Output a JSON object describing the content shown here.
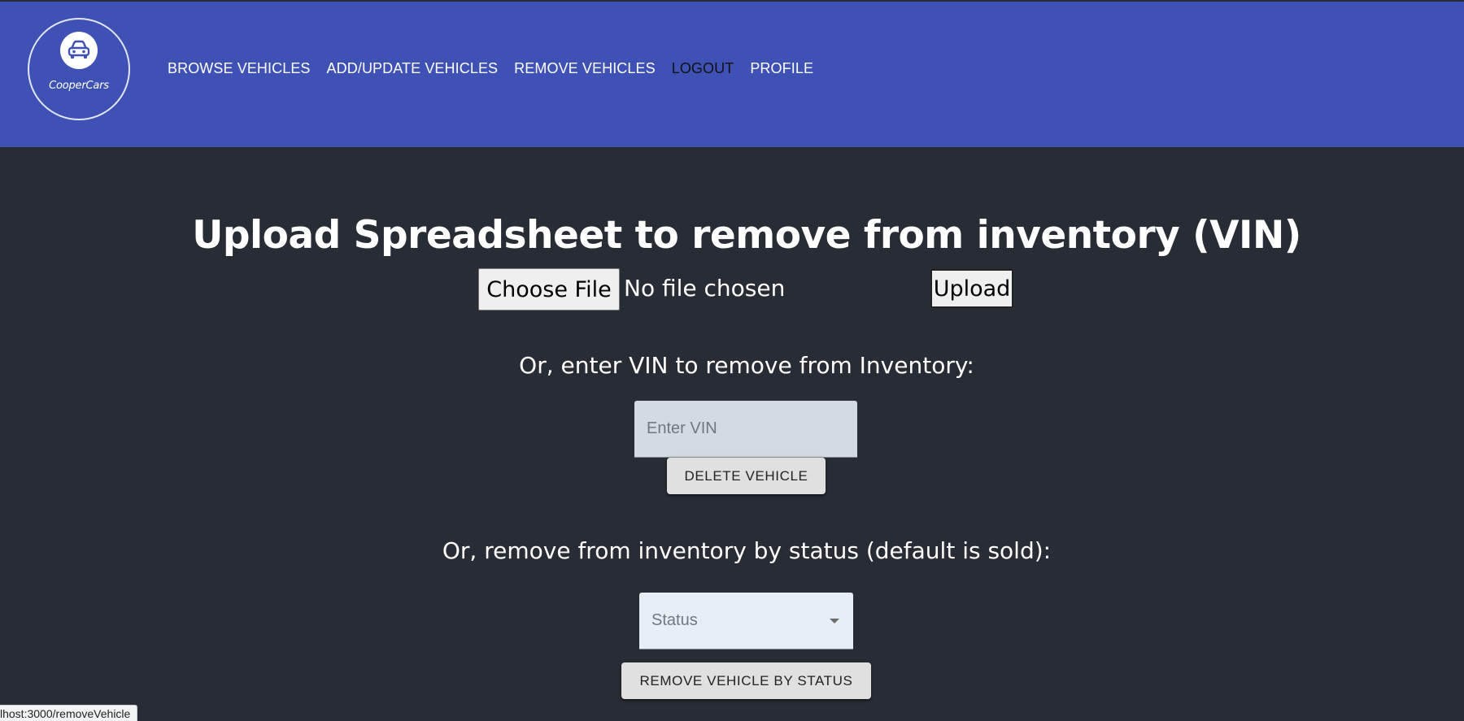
{
  "header": {
    "logo_text": "CooperCars",
    "logo_icon": "car-icon",
    "nav": [
      {
        "label": "BROWSE VEHICLES"
      },
      {
        "label": "ADD/UPDATE VEHICLES"
      },
      {
        "label": "REMOVE VEHICLES"
      },
      {
        "label": "LOGOUT",
        "active": true
      },
      {
        "label": "PROFILE"
      }
    ],
    "colors": {
      "background": "#3f51b5",
      "active_link": "#111111"
    }
  },
  "main": {
    "title": "Upload Spreadsheet to remove from inventory (VIN)",
    "upload": {
      "choose_file_label": "Choose File",
      "file_status": "No file chosen",
      "upload_label": "Upload"
    },
    "vin_section": {
      "label": "Or, enter VIN to remove from Inventory:",
      "input_placeholder": "Enter VIN",
      "input_value": "",
      "button_label": "DELETE VEHICLE"
    },
    "status_section": {
      "label": "Or, remove from inventory by status (default is sold):",
      "select_value": "Status",
      "select_icon": "dropdown-arrow-icon",
      "button_label": "REMOVE VEHICLE BY STATUS"
    },
    "colors": {
      "background": "#282c34"
    }
  },
  "browser_status": {
    "url": "lhost:3000/removeVehicle"
  }
}
